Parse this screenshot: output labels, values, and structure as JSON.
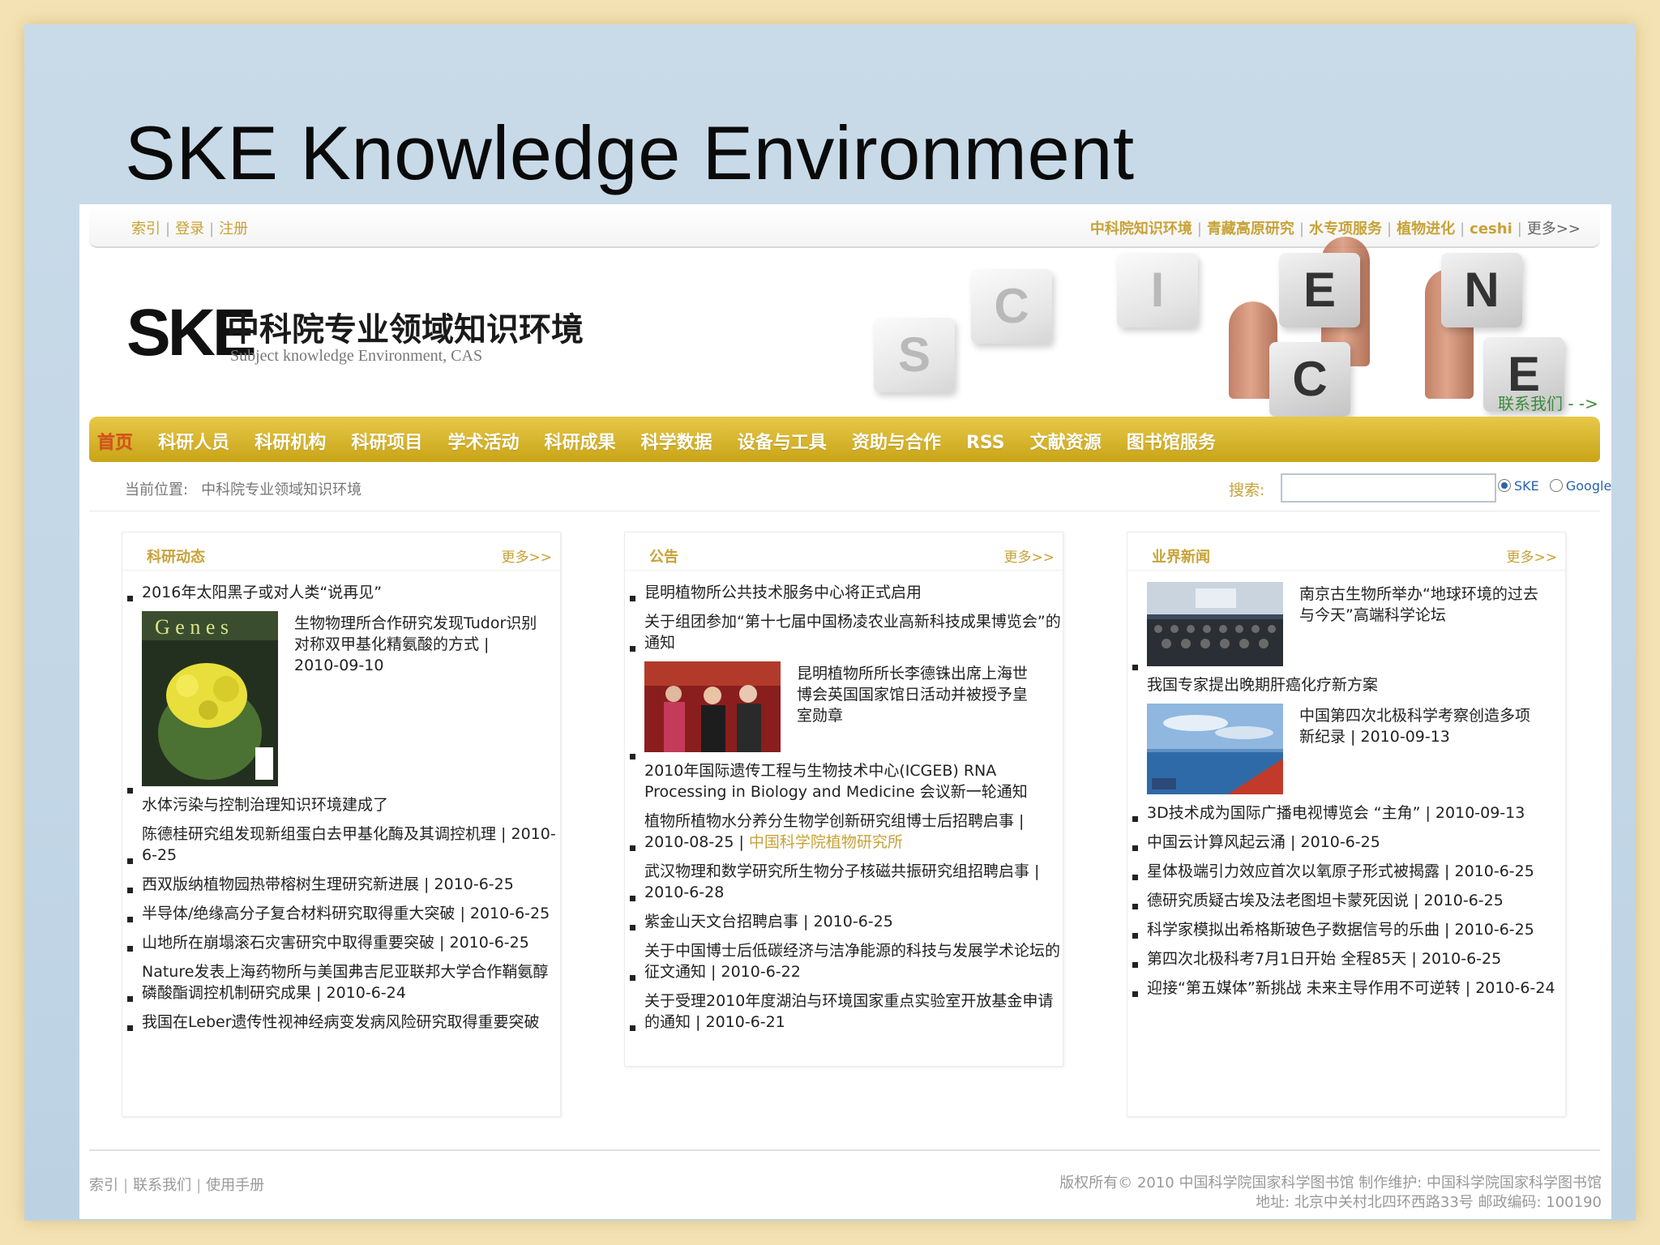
{
  "slide": {
    "title": "SKE Knowledge Environment"
  },
  "topbar": {
    "left_links": [
      "索引",
      "登录",
      "注册"
    ],
    "right_links": [
      "中科院知识环境",
      "青藏高原研究",
      "水专项服务",
      "植物进化",
      "ceshi"
    ],
    "more": "更多>>"
  },
  "header": {
    "logo_text": "SKE",
    "site_name_cn": "中科院专业领域知识环境",
    "site_name_en": "Subject knowledge Environment, CAS",
    "banner_letters": [
      "S",
      "C",
      "I",
      "E",
      "N",
      "C",
      "E"
    ],
    "contact": "联系我们 - ->"
  },
  "nav": {
    "items": [
      "首页",
      "科研人员",
      "科研机构",
      "科研项目",
      "学术活动",
      "科研成果",
      "科学数据",
      "设备与工具",
      "资助与合作",
      "RSS",
      "文献资源",
      "图书馆服务"
    ],
    "active_index": 0
  },
  "breadcrumb": {
    "label": "当前位置:",
    "value": "中科院专业领域知识环境"
  },
  "search": {
    "label": "搜索:",
    "value": "",
    "options": [
      "SKE",
      "Google"
    ],
    "selected": "SKE"
  },
  "columns": [
    {
      "title": "科研动态",
      "more": "更多>>",
      "items": [
        {
          "text": "2016年太阳黑子或对人类“说再见”"
        },
        {
          "feature": true,
          "text": "生物物理所合作研究发现Tudor识别对称双甲基化精氨酸的方式 | 2010-09-10"
        },
        {
          "text": "水体污染与控制治理知识环境建成了"
        },
        {
          "text": "陈德桂研究组发现新组蛋白去甲基化酶及其调控机理 | 2010-6-25"
        },
        {
          "text": "西双版纳植物园热带榕树生理研究新进展 | 2010-6-25"
        },
        {
          "text": "半导体/绝缘高分子复合材料研究取得重大突破 | 2010-6-25"
        },
        {
          "text": "山地所在崩塌滚石灾害研究中取得重要突破 | 2010-6-25"
        },
        {
          "text": "Nature发表上海药物所与美国弗吉尼亚联邦大学合作鞘氨醇磷酸酯调控机制研究成果 | 2010-6-24"
        },
        {
          "text": "我国在Leber遗传性视神经病变发病风险研究取得重要突破"
        }
      ]
    },
    {
      "title": "公告",
      "more": "更多>>",
      "items": [
        {
          "text": "昆明植物所公共技术服务中心将正式启用"
        },
        {
          "text": "关于组团参加“第十七届中国杨凌农业高新科技成果博览会”的通知"
        },
        {
          "feature": true,
          "text": "昆明植物所所长李德铢出席上海世博会英国国家馆日活动并被授予皇室勋章"
        },
        {
          "text": "2010年国际遗传工程与生物技术中心(ICGEB) RNA Processing in Biology and Medicine 会议新一轮通知"
        },
        {
          "text": "植物所植物水分养分生物学创新研究组博士后招聘启事 | 2010-08-25 | ",
          "green": "中国科学院植物研究所"
        },
        {
          "text": "武汉物理和数学研究所生物分子核磁共振研究组招聘启事 | 2010-6-28"
        },
        {
          "text": "紫金山天文台招聘启事 | 2010-6-25"
        },
        {
          "text": "关于中国博士后低碳经济与洁净能源的科技与发展学术论坛的征文通知 | 2010-6-22"
        },
        {
          "text": "关于受理2010年度湖泊与环境国家重点实验室开放基金申请的通知 | 2010-6-21"
        }
      ]
    },
    {
      "title": "业界新闻",
      "more": "更多>>",
      "items": [
        {
          "feature": true,
          "text": "南京古生物所举办“地球环境的过去与今天”高端科学论坛"
        },
        {
          "text": "我国专家提出晚期肝癌化疗新方案"
        },
        {
          "feature": true,
          "text": "中国第四次北极科学考察创造多项新纪录 | 2010-09-13"
        },
        {
          "text": "3D技术成为国际广播电视博览会 “主角” | 2010-09-13"
        },
        {
          "text": "中国云计算风起云涌 | 2010-6-25"
        },
        {
          "text": "星体极端引力效应首次以氧原子形式被揭露 | 2010-6-25"
        },
        {
          "text": "德研究质疑古埃及法老图坦卡蒙死因说 | 2010-6-25"
        },
        {
          "text": "科学家模拟出希格斯玻色子数据信号的乐曲 | 2010-6-25"
        },
        {
          "text": "第四次北极科考7月1日开始 全程85天 | 2010-6-25"
        },
        {
          "text": "迎接“第五媒体”新挑战 未来主导作用不可逆转 | 2010-6-24"
        }
      ]
    }
  ],
  "footer": {
    "left_links": [
      "索引",
      "联系我们",
      "使用手册"
    ],
    "copyright": "版权所有© 2010 中国科学院国家科学图书馆 制作维护: 中国科学院国家科学图书馆",
    "address": "地址: 北京中关村北四环西路33号 邮政编码: 100190"
  },
  "colors": {
    "accent": "#c8a237",
    "nav": "#d9b832",
    "active_nav": "#d94f1a",
    "slide_bg": "#c4d7e6"
  }
}
